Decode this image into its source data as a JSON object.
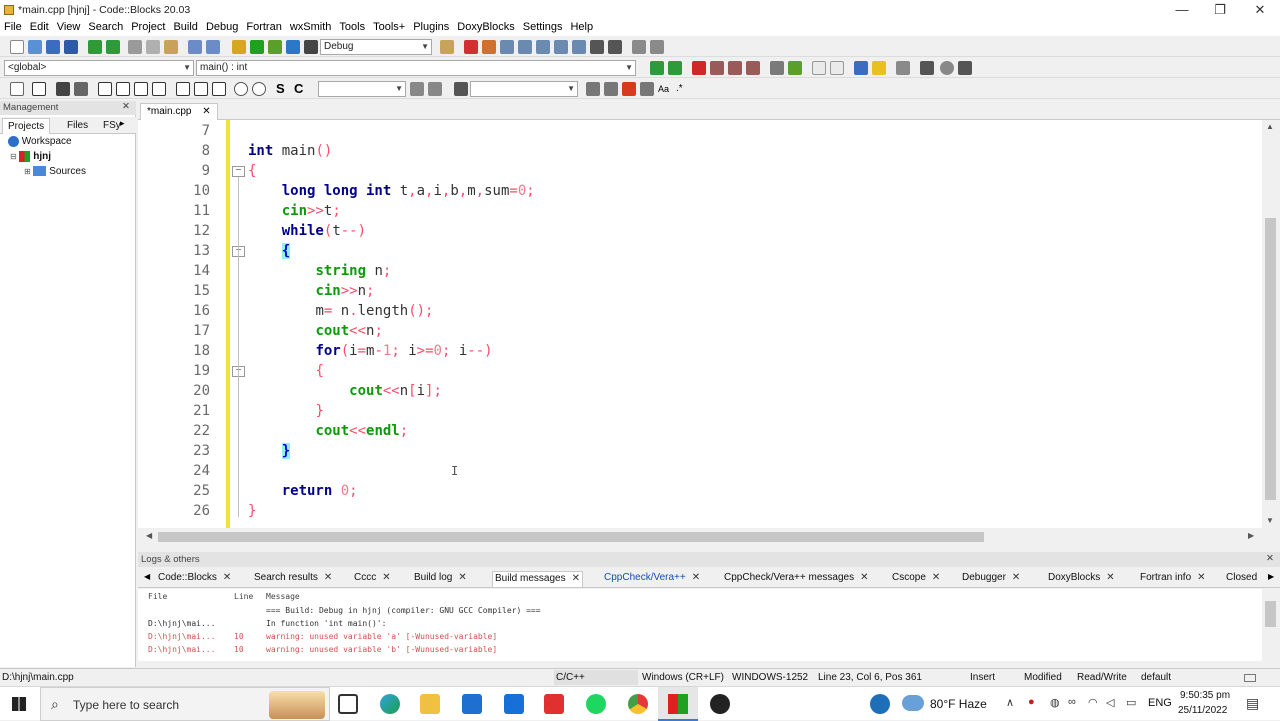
{
  "window": {
    "title": "*main.cpp [hjnj] - Code::Blocks 20.03",
    "minimize_glyph": "—",
    "maximize_glyph": "❐",
    "close_glyph": "✕"
  },
  "menu": [
    "File",
    "Edit",
    "View",
    "Search",
    "Project",
    "Build",
    "Debug",
    "Fortran",
    "wxSmith",
    "Tools",
    "Tools+",
    "Plugins",
    "DoxyBlocks",
    "Settings",
    "Help"
  ],
  "toolbar": {
    "build_target": "Debug",
    "scope": "<global>",
    "symbol": "main() : int",
    "search_value": "",
    "replace_value": ""
  },
  "management": {
    "header": "Management",
    "tabs": [
      "Projects",
      "Files",
      "FSy"
    ],
    "tree": [
      {
        "label": "Workspace",
        "icon": "workspace-icon"
      },
      {
        "label": "hjnj",
        "icon": "project-icon"
      },
      {
        "label": "Sources",
        "icon": "folder-icon"
      }
    ]
  },
  "editor": {
    "tab_label": "*main.cpp",
    "first_line_number": 7,
    "line_numbers": [
      "7",
      "8",
      "9",
      "10",
      "11",
      "12",
      "13",
      "14",
      "15",
      "16",
      "17",
      "18",
      "19",
      "20",
      "21",
      "22",
      "23",
      "24",
      "25",
      "26"
    ],
    "cursor_glyph": "I"
  },
  "logs": {
    "header": "Logs & others",
    "tabs": [
      "Code::Blocks",
      "Search results",
      "Cccc",
      "Build log",
      "Build messages",
      "CppCheck/Vera++",
      "CppCheck/Vera++ messages",
      "Cscope",
      "Debugger",
      "DoxyBlocks",
      "Fortran info",
      "Closed"
    ],
    "active_tab": "Build messages",
    "columns": [
      "File",
      "Line",
      "Message"
    ],
    "rows": [
      {
        "file": "",
        "line": "",
        "message": "=== Build: Debug in hjnj (compiler: GNU GCC Compiler) ==="
      },
      {
        "file": "D:\\hjnj\\mai...",
        "line": "",
        "message": "In function 'int main()':"
      },
      {
        "file": "D:\\hjnj\\mai...",
        "line": "10",
        "message": "warning: unused variable 'a' [-Wunused-variable]"
      },
      {
        "file": "D:\\hjnj\\mai...",
        "line": "10",
        "message": "warning: unused variable 'b' [-Wunused-variable]"
      }
    ]
  },
  "statusbar": {
    "path": "D:\\hjnj\\main.cpp",
    "language": "C/C++",
    "eol": "Windows (CR+LF)",
    "encoding": "WINDOWS-1252",
    "position": "Line 23, Col 6, Pos 361",
    "mode": "Insert",
    "modified": "Modified",
    "access": "Read/Write",
    "profile": "default"
  },
  "taskbar": {
    "search_placeholder": "Type here to search",
    "weather": "80°F Haze",
    "language": "ENG",
    "time": "9:50:35 pm",
    "date": "25/11/2022"
  },
  "colors": {
    "keyword": "#00008b",
    "type": "#0a9a0a",
    "number": "#f07d8d",
    "change_bar": "#f0e438",
    "brace_highlight": "#90f0f0"
  }
}
